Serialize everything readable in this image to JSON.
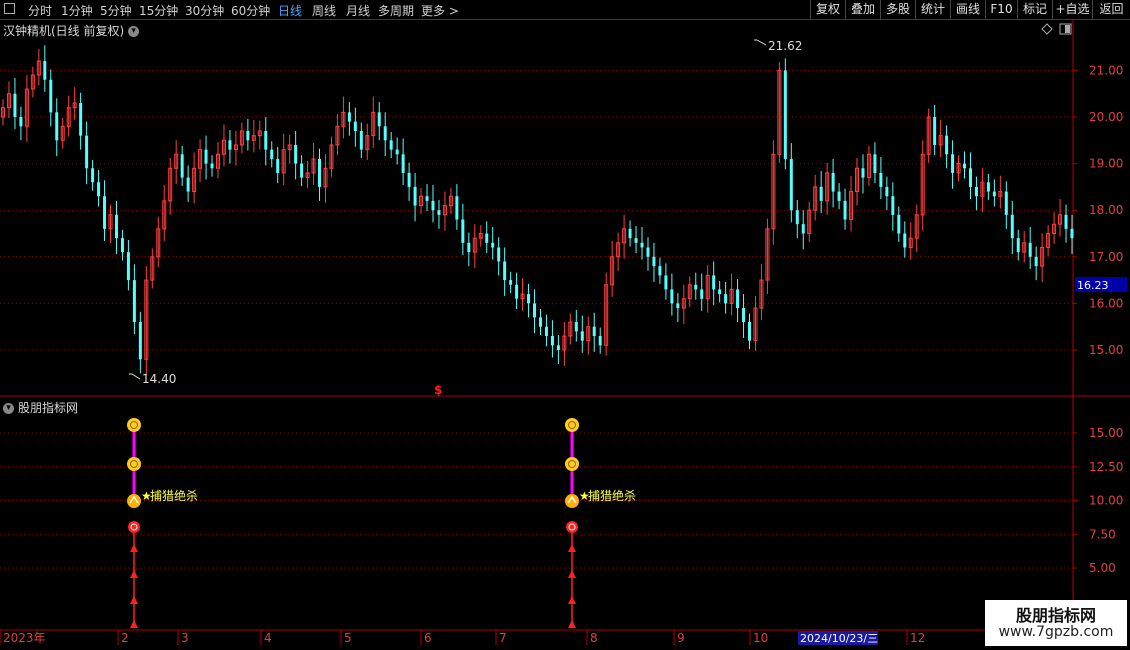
{
  "toolbar": {
    "periods": [
      "分时",
      "1分钟",
      "5分钟",
      "15分钟",
      "30分钟",
      "60分钟",
      "日线",
      "周线",
      "月线",
      "多周期",
      "更多"
    ],
    "active_period": "日线",
    "more_arrow": ">",
    "right_buttons": [
      "复权",
      "叠加",
      "多股",
      "统计",
      "画线",
      "F10",
      "标记",
      "+自选",
      "返回"
    ]
  },
  "main_chart": {
    "title": "汉钟精机(日线 前复权)",
    "price_axis": [
      "21.00",
      "20.00",
      "19.00",
      "18.00",
      "17.00",
      "16.00",
      "15.00"
    ],
    "current_price": "16.23",
    "high_label": "21.62",
    "low_label": "14.40",
    "marker_symbol": "$"
  },
  "indicator": {
    "title": "股朋指标网",
    "axis": [
      "15.00",
      "12.50",
      "10.00",
      "7.50",
      "5.00"
    ],
    "signal_text": "捕猎绝杀",
    "signal_star": "★"
  },
  "time_axis": {
    "labels": [
      "2023年",
      "2",
      "3",
      "4",
      "5",
      "6",
      "7",
      "8",
      "9",
      "10",
      "11",
      "12"
    ],
    "highlight_date": "2024/10/23/三"
  },
  "watermark": {
    "title": "股朋指标网",
    "url": "www.7gpzb.com"
  },
  "colors": {
    "up": "#ff4040",
    "down": "#54ffff",
    "grid": "#8b0000",
    "accent": "#4aa3ff"
  },
  "chart_data": {
    "type": "candlestick",
    "ylim": [
      14.4,
      21.62
    ],
    "last_price": 16.23,
    "closes": [
      20.2,
      20.5,
      20.0,
      19.8,
      20.6,
      20.9,
      21.2,
      20.8,
      20.1,
      19.5,
      19.8,
      20.2,
      20.3,
      19.6,
      18.9,
      18.6,
      18.3,
      17.6,
      17.9,
      17.4,
      17.1,
      16.5,
      15.6,
      14.8,
      16.5,
      17.0,
      17.6,
      18.2,
      18.9,
      19.2,
      18.7,
      18.4,
      18.9,
      19.3,
      19.0,
      18.9,
      19.2,
      19.5,
      19.3,
      19.4,
      19.7,
      19.5,
      19.6,
      19.7,
      19.3,
      19.1,
      18.8,
      19.3,
      19.4,
      19.0,
      18.7,
      18.8,
      19.1,
      18.5,
      18.9,
      19.4,
      19.8,
      20.1,
      19.9,
      19.7,
      19.3,
      19.6,
      20.1,
      19.8,
      19.5,
      19.3,
      19.2,
      18.8,
      18.5,
      18.1,
      18.3,
      18.2,
      18.0,
      17.9,
      18.1,
      18.3,
      17.8,
      17.3,
      17.1,
      17.4,
      17.5,
      17.3,
      17.2,
      16.9,
      16.5,
      16.4,
      16.1,
      16.2,
      16.0,
      15.7,
      15.5,
      15.3,
      15.1,
      15.0,
      15.3,
      15.6,
      15.4,
      15.2,
      15.5,
      15.3,
      15.1,
      16.4,
      17.0,
      17.3,
      17.6,
      17.4,
      17.3,
      17.2,
      17.0,
      16.8,
      16.6,
      16.3,
      16.0,
      15.9,
      16.1,
      16.4,
      16.3,
      16.1,
      16.6,
      16.3,
      16.2,
      16.0,
      16.3,
      15.9,
      15.6,
      15.2,
      15.9,
      16.5,
      17.6,
      19.2,
      21.0,
      19.1,
      18.0,
      17.7,
      17.5,
      18.0,
      18.5,
      18.2,
      18.8,
      18.4,
      18.2,
      17.8,
      18.4,
      18.9,
      18.7,
      19.2,
      18.8,
      18.5,
      18.3,
      17.9,
      17.5,
      17.2,
      17.4,
      17.9,
      19.2,
      20.0,
      19.4,
      19.6,
      19.2,
      18.8,
      19.0,
      18.9,
      18.5,
      18.3,
      18.6,
      18.4,
      18.3,
      18.4,
      17.9,
      17.4,
      17.1,
      17.3,
      17.0,
      16.8,
      17.2,
      17.5,
      17.7,
      17.9,
      17.6,
      17.4
    ]
  }
}
